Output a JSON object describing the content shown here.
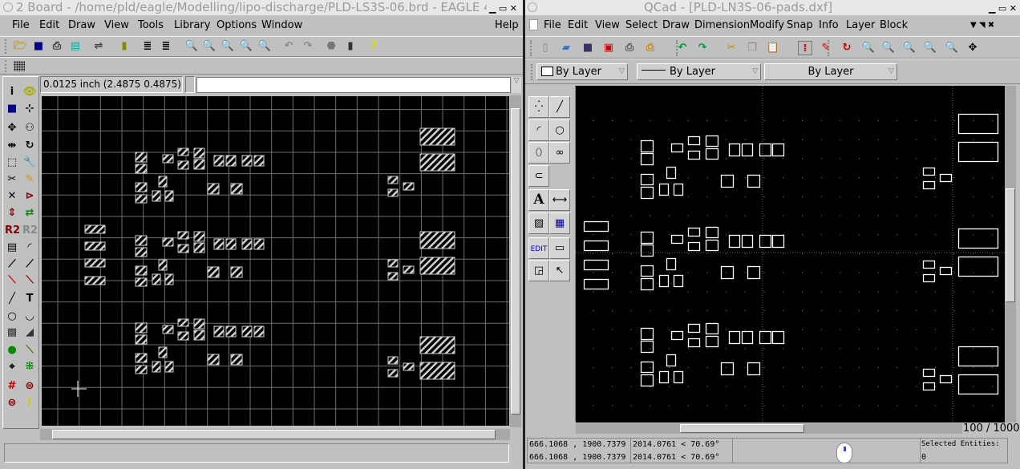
{
  "eagle": {
    "title": "2 Board - /home/pld/eagle/Modelling/lipo-discharge/PLD-LS3S-06.brd - EAGLE 4.",
    "menu": [
      "File",
      "Edit",
      "Draw",
      "View",
      "Tools",
      "Library",
      "Options",
      "Window"
    ],
    "help": "Help",
    "toolbar": [
      "open-icon",
      "save-icon",
      "print-icon",
      "cam-processor-icon",
      "board-schematic-icon",
      "library-icon",
      "script-icon",
      "ulp-icon",
      "zoom-fit-icon",
      "zoom-in-icon",
      "zoom-out-icon",
      "zoom-redraw-icon",
      "zoom-select-icon",
      "undo-icon",
      "redo-icon",
      "stop-icon",
      "go-icon",
      "help-icon"
    ],
    "coord": "0.0125 inch (2.4875 0.4875)",
    "command_value": "",
    "palette": [
      "info-icon",
      "show-icon",
      "display-layers-icon",
      "mark-icon",
      "move-icon",
      "copy-icon",
      "mirror-icon",
      "rotate-icon",
      "group-icon",
      "change-icon",
      "cut-icon",
      "paste-icon",
      "delete-icon",
      "add-icon",
      "pinswap-icon",
      "replace-icon",
      "name-icon",
      "value-icon",
      "smash-icon",
      "miter-icon",
      "split-icon",
      "optimize-icon",
      "route-icon",
      "ripup-icon",
      "wire-icon",
      "text-icon",
      "circle-icon",
      "arc-icon",
      "rect-icon",
      "polygon-icon",
      "via-icon",
      "signal-icon",
      "hole-icon",
      "ratsnest-icon",
      "auto-icon",
      "erc-icon",
      "drc-icon",
      "errors-icon"
    ],
    "status": ""
  },
  "qcad": {
    "title": "QCad - [PLD-LN3S-06-pads.dxf]",
    "menu": [
      "File",
      "Edit",
      "View",
      "Select",
      "Draw",
      "Dimension",
      "Modify",
      "Snap",
      "Info",
      "Layer",
      "Block"
    ],
    "toolbar": [
      "new-icon",
      "open-icon",
      "save-icon",
      "save-as-icon",
      "print-icon",
      "print-preview-icon",
      "undo-icon",
      "redo-icon",
      "cut-icon",
      "copy-icon",
      "paste-icon",
      "grid-icon",
      "draft-icon",
      "redraw-icon",
      "zoom-in-icon",
      "zoom-out-icon",
      "zoom-auto-icon",
      "zoom-previous-icon",
      "zoom-window-icon",
      "zoom-pan-icon"
    ],
    "pen": {
      "color": "By Layer",
      "width": "By Layer",
      "type": "By Layer"
    },
    "palette": [
      "points-icon",
      "lines-icon",
      "arcs-icon",
      "circles-icon",
      "ellipses-icon",
      "splines-icon",
      "polylines-icon",
      "text-icon",
      "dimensions-icon",
      "hatch-icon",
      "image-icon",
      "edit-icon",
      "measure-icon",
      "block-icon",
      "select-icon"
    ],
    "palette_edit_label": "EDIT",
    "grid_label": "100 / 1000",
    "status": {
      "abs_coord": "666.1068 , 1900.7379",
      "rel_coord": "666.1068 , 1900.7379",
      "abs_polar": "2014.0761 < 70.69°",
      "rel_polar": "2014.0761 < 70.69°",
      "selected_label": "Selected Entities:",
      "selected_count": "0"
    }
  },
  "colors": {
    "pad": "#d0d0d0",
    "grid_eagle": "#707070",
    "qcad_outline": "#ffffff",
    "accent_blue": "#0000cc"
  }
}
